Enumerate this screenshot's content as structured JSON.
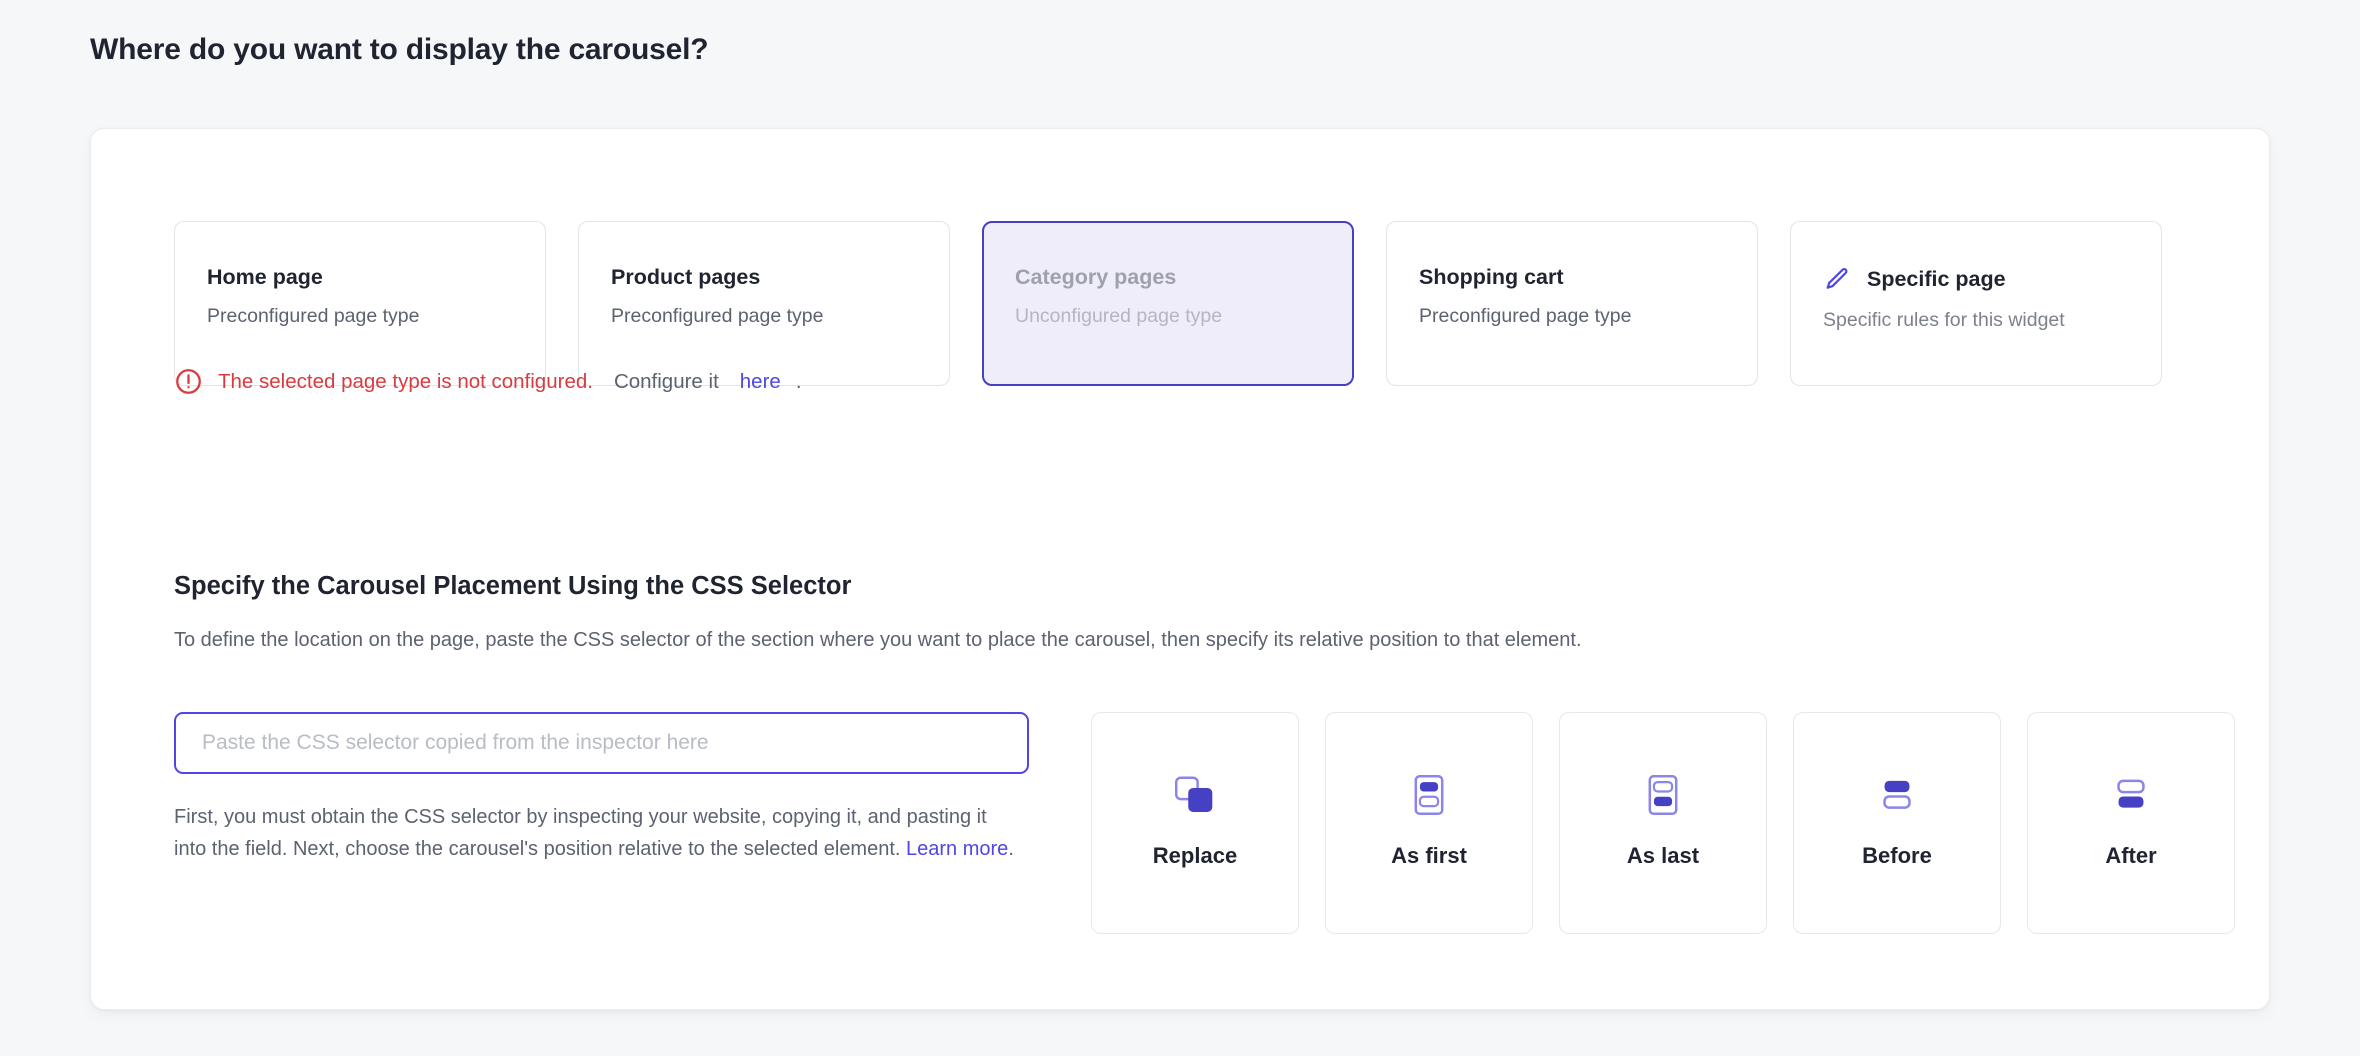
{
  "header": {
    "title": "Where do you want to display the carousel?"
  },
  "page_types": [
    {
      "title": "Home page",
      "subtitle": "Preconfigured page type",
      "selected": false,
      "icon": null
    },
    {
      "title": "Product pages",
      "subtitle": "Preconfigured page type",
      "selected": false,
      "icon": null
    },
    {
      "title": "Category pages",
      "subtitle": "Unconfigured page type",
      "selected": true,
      "icon": null
    },
    {
      "title": "Shopping cart",
      "subtitle": "Preconfigured page type",
      "selected": false,
      "icon": null
    },
    {
      "title": "Specific page",
      "subtitle": "Specific rules for this widget",
      "selected": false,
      "icon": "pencil-icon"
    }
  ],
  "error": {
    "icon": "error-circle-icon",
    "message": "The selected page type is not configured.",
    "suffix": "Configure it",
    "link": "here",
    "period": "."
  },
  "selector_section": {
    "heading": "Specify the Carousel Placement Using the CSS Selector",
    "description": "To define the location on the page, paste the CSS selector of the section where you want to place the carousel, then specify its relative position to that element.",
    "input": {
      "value": "",
      "placeholder": "Paste the CSS selector copied from the inspector here"
    },
    "helper": {
      "text": "First, you must obtain the CSS selector by inspecting your website, copying it, and pasting it into the field. Next, choose the carousel's position relative to the selected element.",
      "link": "Learn more",
      "period": "."
    }
  },
  "positions": [
    {
      "label": "Replace",
      "icon": "replace-icon"
    },
    {
      "label": "As first",
      "icon": "as-first-icon"
    },
    {
      "label": "As last",
      "icon": "as-last-icon"
    },
    {
      "label": "Before",
      "icon": "before-icon"
    },
    {
      "label": "After",
      "icon": "after-icon"
    }
  ],
  "colors": {
    "accent": "#4f46e5",
    "accent_border_selected": "#4540c4",
    "accent_fill_selected": "#eeedf9",
    "error_red": "#d83b40",
    "page_bg": "#f6f7f9",
    "panel_bg": "#ffffff",
    "text_primary": "#1f2430",
    "text_secondary": "#5c6270",
    "text_muted": "#b4b6c0"
  }
}
